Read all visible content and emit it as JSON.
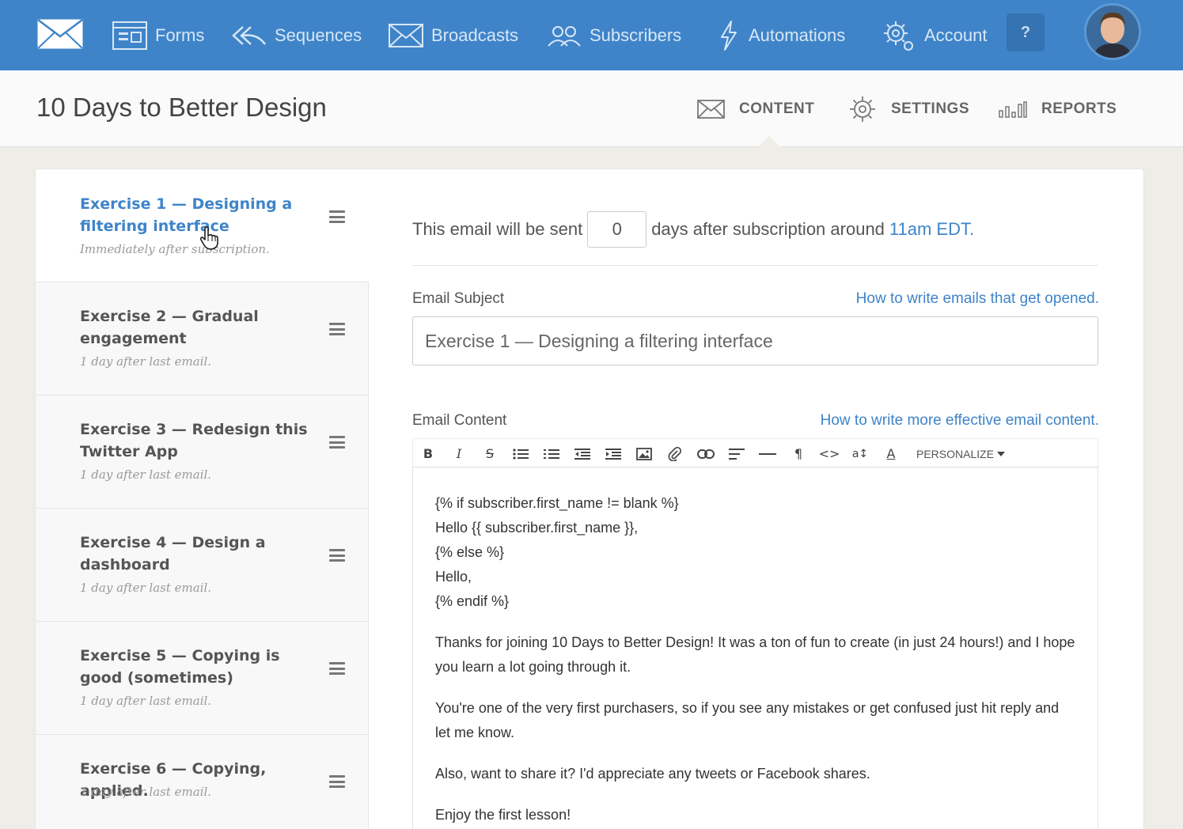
{
  "nav": {
    "items": [
      {
        "label": "Forms",
        "icon": "forms-icon"
      },
      {
        "label": "Sequences",
        "icon": "sequences-icon"
      },
      {
        "label": "Broadcasts",
        "icon": "broadcasts-icon"
      },
      {
        "label": "Subscribers",
        "icon": "subscribers-icon"
      },
      {
        "label": "Automations",
        "icon": "automations-icon"
      },
      {
        "label": "Account",
        "icon": "account-gear-icon"
      }
    ],
    "help_label": "?"
  },
  "header": {
    "title": "10 Days to Better Design",
    "tabs": [
      {
        "label": "CONTENT",
        "icon": "envelope-icon",
        "active": true
      },
      {
        "label": "SETTINGS",
        "icon": "gear-icon",
        "active": false
      },
      {
        "label": "REPORTS",
        "icon": "bar-chart-icon",
        "active": false
      }
    ]
  },
  "emails": [
    {
      "title": "Exercise 1 — Designing a filtering interface",
      "timing": "Immediately after subscription.",
      "active": true
    },
    {
      "title": "Exercise 2 — Gradual engagement",
      "timing": "1 day after last email.",
      "active": false
    },
    {
      "title": "Exercise 3 — Redesign this Twitter App",
      "timing": "1 day after last email.",
      "active": false
    },
    {
      "title": "Exercise 4 — Design a dashboard",
      "timing": "1 day after last email.",
      "active": false
    },
    {
      "title": "Exercise 5 — Copying is good (sometimes)",
      "timing": "1 day after last email.",
      "active": false
    },
    {
      "title": "Exercise 6 — Copying, applied.",
      "timing": "1 day after last email.",
      "active": false
    }
  ],
  "content": {
    "send_prefix": "This email will be sent",
    "send_days": "0",
    "send_suffix": "days after subscription around",
    "send_time": "11am EDT.",
    "subject_label": "Email Subject",
    "subject_help": "How to write emails that get opened.",
    "subject_value": "Exercise 1 — Designing a filtering interface",
    "content_label": "Email Content",
    "content_help": "How to write more effective email content.",
    "personalize_label": "PERSONALIZE",
    "body_code": [
      "{% if subscriber.first_name != blank %}",
      "Hello {{ subscriber.first_name }},",
      "{% else %}",
      "Hello,",
      "{% endif %}"
    ],
    "body_paragraphs": [
      "Thanks for joining 10 Days to Better Design! It was a ton of fun to create (in just 24 hours!) and I hope you learn a lot going through it.",
      "You're one of the very first purchasers, so if you see any mistakes or get confused just hit reply and let me know.",
      "Also, want to share it? I'd appreciate any tweets or Facebook shares.",
      "Enjoy the first lesson!"
    ]
  },
  "toolbar": {
    "bold": "B",
    "italic": "I",
    "strike": "S",
    "paragraph": "¶",
    "code": "<>",
    "font_size": "a↕",
    "text_color": "A"
  },
  "colors": {
    "brand": "#3f84c9",
    "link": "#3f84c9",
    "background": "#efede8"
  }
}
